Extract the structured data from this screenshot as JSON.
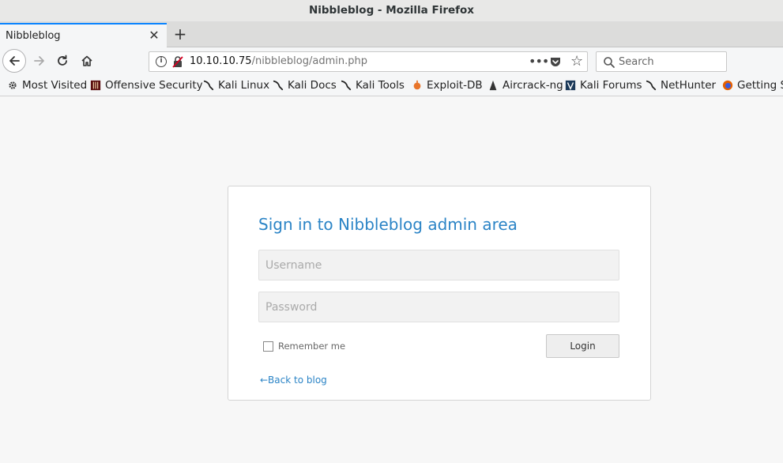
{
  "window": {
    "title": "Nibbleblog - Mozilla Firefox"
  },
  "tabs": [
    {
      "label": "Nibbleblog",
      "active": true
    }
  ],
  "toolbar": {
    "url_host": "10.10.10.75",
    "url_path": "/nibbleblog/admin.php",
    "search_placeholder": "Search"
  },
  "bookmarks": [
    {
      "label": "Most Visited",
      "icon": "gear-icon"
    },
    {
      "label": "Offensive Security",
      "icon": "offsec-icon"
    },
    {
      "label": "Kali Linux",
      "icon": "kali-icon"
    },
    {
      "label": "Kali Docs",
      "icon": "kali-icon"
    },
    {
      "label": "Kali Tools",
      "icon": "kali-icon"
    },
    {
      "label": "Exploit-DB",
      "icon": "exploitdb-icon"
    },
    {
      "label": "Aircrack-ng",
      "icon": "aircrack-icon"
    },
    {
      "label": "Kali Forums",
      "icon": "forums-icon"
    },
    {
      "label": "NetHunter",
      "icon": "kali-icon"
    },
    {
      "label": "Getting St",
      "icon": "firefox-icon"
    }
  ],
  "login": {
    "title": "Sign in to Nibbleblog admin area",
    "username_placeholder": "Username",
    "password_placeholder": "Password",
    "remember_label": "Remember me",
    "remember_checked": false,
    "login_button": "Login",
    "back_link": "←Back to blog"
  },
  "colors": {
    "accent": "#2b84c6",
    "tab_highlight": "#0a84ff"
  }
}
